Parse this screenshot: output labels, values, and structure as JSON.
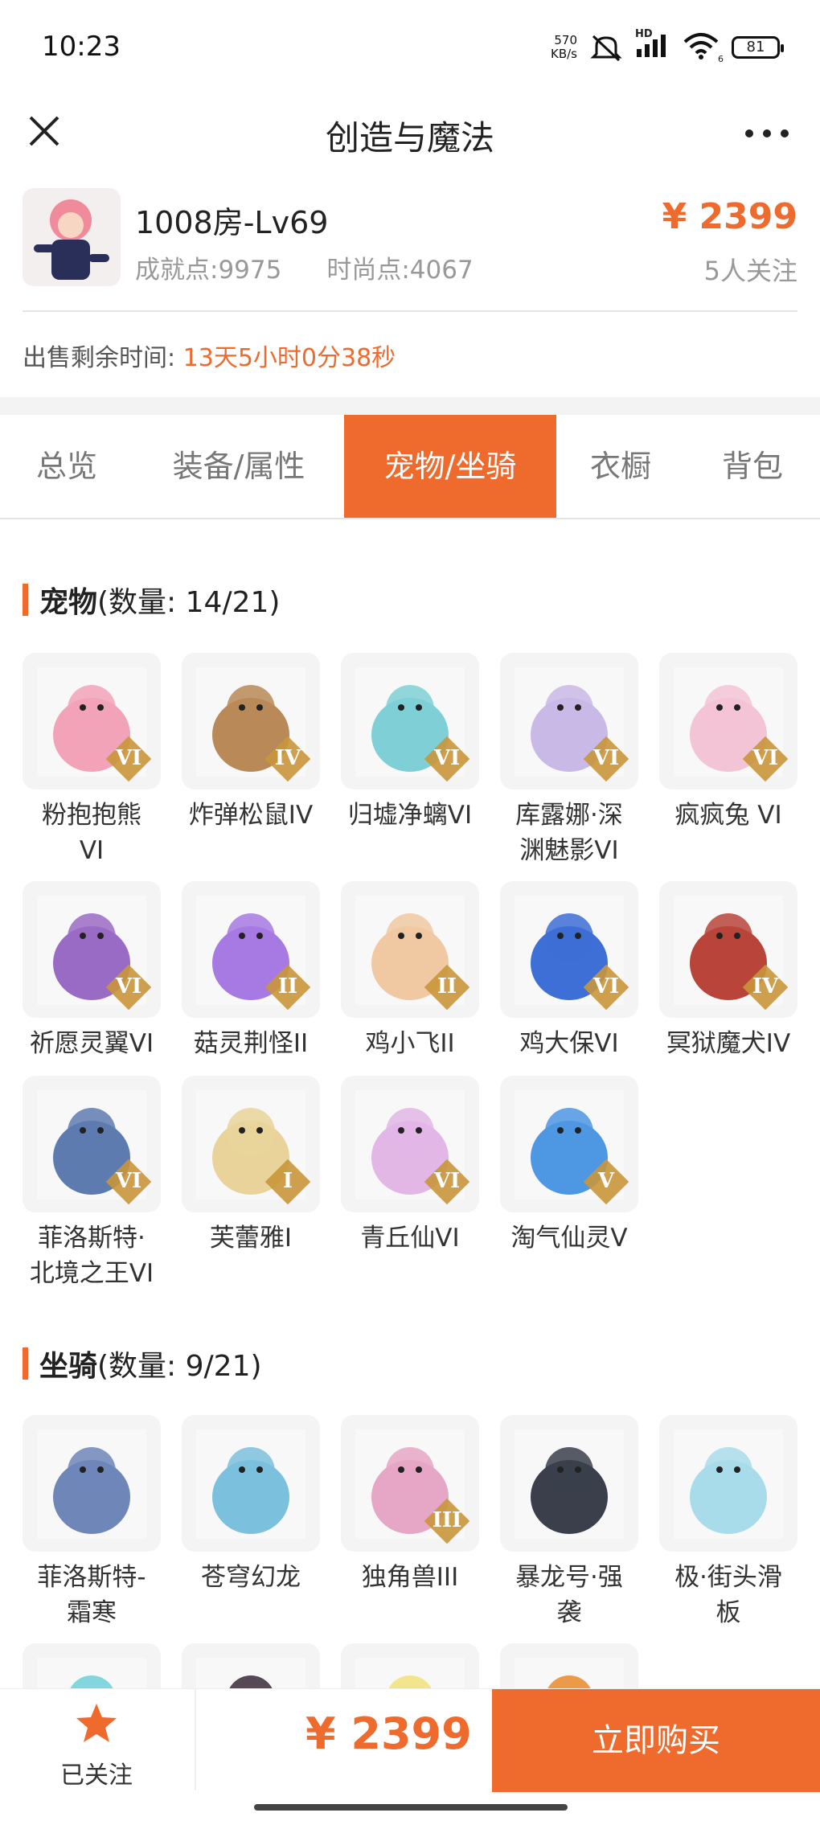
{
  "status_bar": {
    "time": "10:23",
    "speed_value": "570",
    "speed_unit": "KB/s",
    "network": "HD",
    "wifi_sub": "6",
    "battery": "81"
  },
  "nav": {
    "title": "创造与魔法",
    "close_icon": "close-icon",
    "more_icon": "more-icon"
  },
  "product": {
    "name": "1008房-Lv69",
    "achievement": "成就点:9975",
    "fashion": "时尚点:4067",
    "price": "¥ 2399",
    "follows": "5人关注"
  },
  "remaining": {
    "label": "出售剩余时间:",
    "value": "13天5小时0分38秒"
  },
  "tabs": [
    {
      "label": "总览",
      "active": false
    },
    {
      "label": "装备/属性",
      "active": false
    },
    {
      "label": "宠物/坐骑",
      "active": true
    },
    {
      "label": "衣橱",
      "active": false
    },
    {
      "label": "背包",
      "active": false
    }
  ],
  "pets": {
    "title": "宠物",
    "count": "(数量: 14/21)",
    "items": [
      {
        "name": "粉抱抱熊\nVI",
        "rank": "VI",
        "color": "#f2a3b8"
      },
      {
        "name": "炸弹松鼠IV",
        "rank": "IV",
        "color": "#b98a57"
      },
      {
        "name": "归墟净螭VI",
        "rank": "VI",
        "color": "#7fd0d6"
      },
      {
        "name": "库露娜·深\n渊魅影VI",
        "rank": "VI",
        "color": "#c9b9e6"
      },
      {
        "name": "疯疯兔 VI",
        "rank": "VI",
        "color": "#f3c4d6"
      },
      {
        "name": "祈愿灵翼VI",
        "rank": "VI",
        "color": "#9a6bc4"
      },
      {
        "name": "菇灵荆怪II",
        "rank": "II",
        "color": "#a779e2"
      },
      {
        "name": "鸡小飞II",
        "rank": "II",
        "color": "#f0c9a2"
      },
      {
        "name": "鸡大保VI",
        "rank": "VI",
        "color": "#3d6fd6"
      },
      {
        "name": "冥狱魔犬IV",
        "rank": "IV",
        "color": "#b8443a"
      },
      {
        "name": "菲洛斯特·\n北境之王VI",
        "rank": "VI",
        "color": "#5e7bb0"
      },
      {
        "name": "芙蕾雅I",
        "rank": "I",
        "color": "#e9d39a"
      },
      {
        "name": "青丘仙VI",
        "rank": "VI",
        "color": "#e2b7e6"
      },
      {
        "name": "淘气仙灵V",
        "rank": "V",
        "color": "#4d97e3"
      }
    ]
  },
  "mounts": {
    "title": "坐骑",
    "count": "(数量: 9/21)",
    "items": [
      {
        "name": "菲洛斯特-\n霜寒",
        "rank": "",
        "color": "#6f86b8"
      },
      {
        "name": "苍穹幻龙",
        "rank": "",
        "color": "#7bc0dd"
      },
      {
        "name": "独角兽III",
        "rank": "III",
        "color": "#e6a6c6"
      },
      {
        "name": "暴龙号·强\n袭",
        "rank": "",
        "color": "#3a3f4b"
      },
      {
        "name": "极·街头滑\n板",
        "rank": "",
        "color": "#a9dcea"
      },
      {
        "name": "",
        "rank": "",
        "color": "#6fd0d9"
      },
      {
        "name": "",
        "rank": "",
        "color": "#3a2a3a"
      },
      {
        "name": "",
        "rank": "",
        "color": "#f1e27a"
      },
      {
        "name": "",
        "rank": "",
        "color": "#e98a2a"
      }
    ]
  },
  "bottom": {
    "follow_label": "已关注",
    "price": "¥ 2399",
    "buy_label": "立即购买"
  },
  "colors": {
    "accent": "#ef6a2d",
    "gray_text": "#999999"
  }
}
